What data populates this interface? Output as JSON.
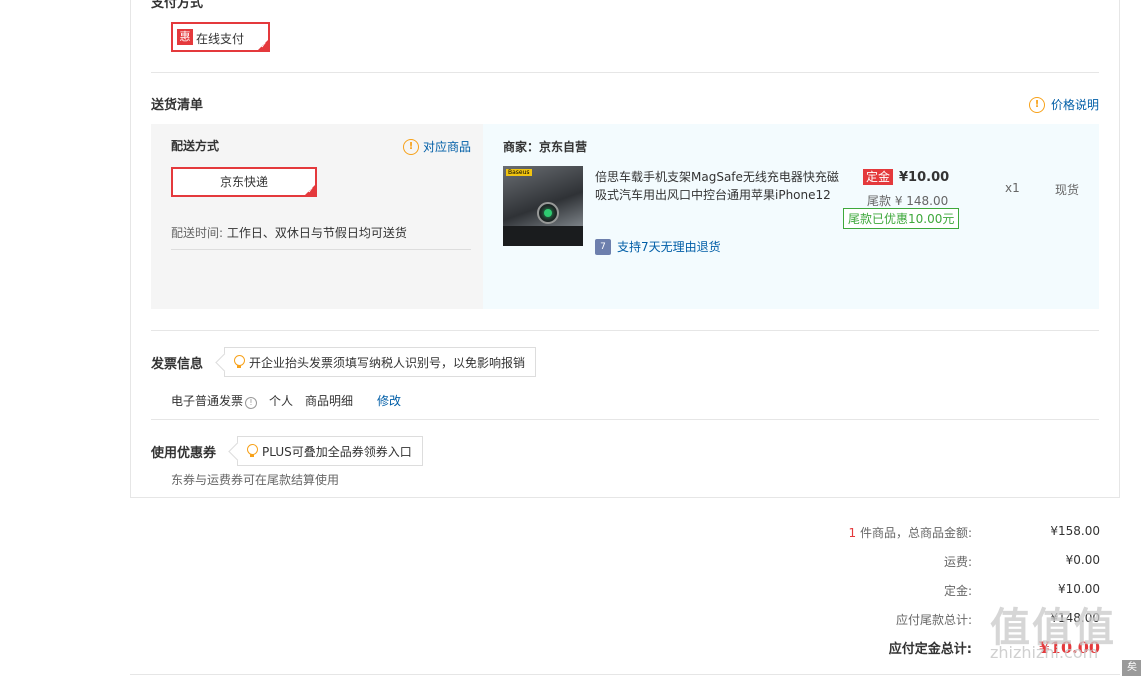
{
  "payment": {
    "title": "支付方式",
    "badge": "惠",
    "option": "在线支付"
  },
  "delivery": {
    "title": "送货清单",
    "price_note": "价格说明",
    "method_title": "配送方式",
    "match_link": "对应商品",
    "method_option": "京东快递",
    "time_label": "配送时间:",
    "time_value": "工作日、双休日与节假日均可送货",
    "merchant": "商家：京东自营",
    "product": {
      "thumb_brand": "Baseus",
      "name": "倍思车载手机支架MagSafe无线充电器快充磁吸式汽车用出风口中控台通用苹果iPhone12手",
      "return_badge": "7",
      "return_text": "支持7天无理由退货",
      "deposit_tag": "定金",
      "deposit_value": "¥10.00",
      "balance": "尾款 ¥ 148.00",
      "discount": "尾款已优惠10.00元",
      "qty": "x1",
      "stock": "现货"
    }
  },
  "invoice": {
    "title": "发票信息",
    "tip": "开企业抬头发票须填写纳税人识别号，以免影响报销",
    "type": "电子普通发票",
    "info_glyph": "!",
    "holder": "个人",
    "content": "商品明细",
    "edit": "修改"
  },
  "coupon": {
    "title": "使用优惠券",
    "tip": "PLUS可叠加全品券领券入口",
    "note": "东券与运费券可在尾款结算使用"
  },
  "summary": {
    "count": "1",
    "goods_label": " 件商品，总商品金额:",
    "goods_value": "¥158.00",
    "freight_label": "运费:",
    "freight_value": "¥0.00",
    "deposit_label": "定金:",
    "deposit_value": "¥10.00",
    "balance_label": "应付尾款总计:",
    "balance_value": "¥148.00",
    "total_label": "应付定金总计:",
    "total_value": "¥10.00"
  },
  "watermark": {
    "main": "值值值",
    "sub": "zhizhizhi.com",
    "badge": "矣"
  },
  "colors": {
    "accent_red": "#e4393c",
    "link_blue": "#005ea7",
    "green": "#3ea83b",
    "warn_orange": "#f7a21b"
  }
}
